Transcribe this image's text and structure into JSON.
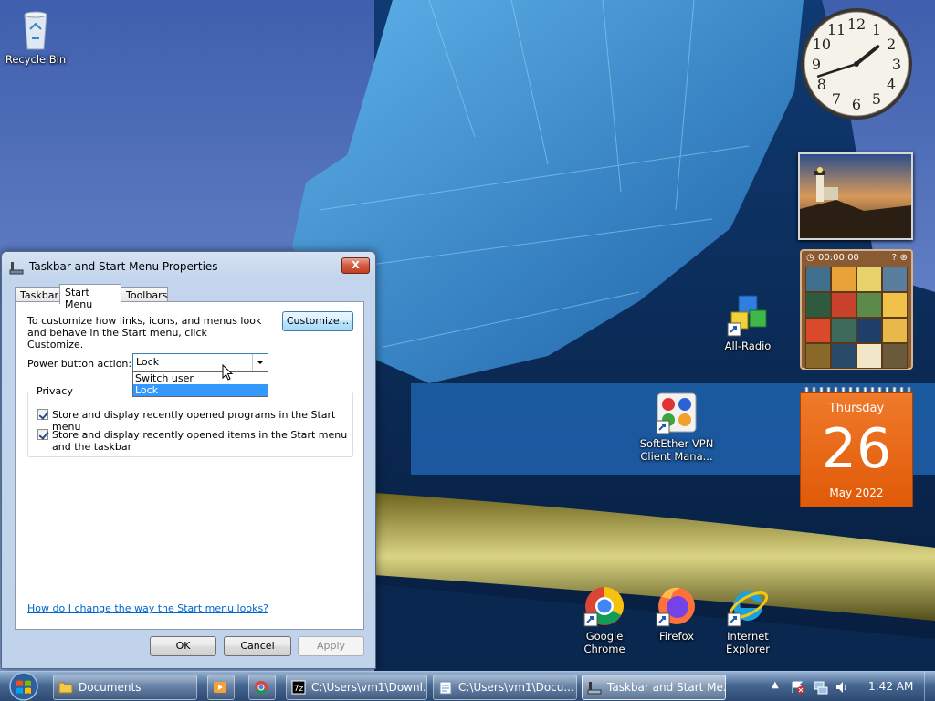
{
  "desktop": {
    "icons": [
      {
        "label": "Recycle Bin",
        "icon": "recycle-bin-icon"
      },
      {
        "label": "All-Radio",
        "icon": "all-radio-icon"
      },
      {
        "label": "SoftEther VPN Client Mana...",
        "icon": "softether-vpn-icon"
      },
      {
        "label": "Google Chrome",
        "icon": "chrome-icon"
      },
      {
        "label": "Firefox",
        "icon": "firefox-icon"
      },
      {
        "label": "Internet Explorer",
        "icon": "internet-explorer-icon"
      }
    ]
  },
  "gadgets": {
    "clock": {
      "numbers": [
        "12",
        "1",
        "2",
        "3",
        "4",
        "5",
        "6",
        "7",
        "8",
        "9",
        "10",
        "11"
      ],
      "time": "1:42"
    },
    "puzzle": {
      "timer": "00:00:00"
    },
    "calendar": {
      "weekday": "Thursday",
      "day": "26",
      "month_year": "May 2022"
    }
  },
  "dialog": {
    "title": "Taskbar and Start Menu Properties",
    "close_label": "X",
    "tabs": [
      "Taskbar",
      "Start Menu",
      "Toolbars"
    ],
    "active_tab": "Start Menu",
    "intro_text": "To customize how links, icons, and menus look and behave in the Start menu, click Customize.",
    "customize_label": "Customize...",
    "power_button_label": "Power button action:",
    "power_button_value": "Lock",
    "power_button_options": [
      "Switch user",
      "Lock"
    ],
    "highlighted_option": "Lock",
    "privacy_legend": "Privacy",
    "checkboxes": [
      {
        "label": "Store and display recently opened programs in the Start menu",
        "checked": true
      },
      {
        "label": "Store and display recently opened items in the Start menu and the taskbar",
        "checked": true
      }
    ],
    "help_link": "How do I change the way the Start menu looks?",
    "ok_label": "OK",
    "cancel_label": "Cancel",
    "apply_label": "Apply"
  },
  "taskbar": {
    "items": [
      {
        "label": "Documents",
        "icon": "folder-icon"
      },
      {
        "label": "",
        "icon": "media-player-icon"
      },
      {
        "label": "",
        "icon": "chrome-icon"
      },
      {
        "label": "C:\\Users\\vm1\\Downl...",
        "icon": "7zip-icon"
      },
      {
        "label": "C:\\Users\\vm1\\Docu...",
        "icon": "notepad-icon"
      },
      {
        "label": "Taskbar and Start Me...",
        "icon": "taskbar-properties-icon"
      }
    ],
    "clock": "1:42 AM"
  },
  "colors": {
    "calendar_orange": "#e8620f",
    "selection_blue": "#3399ff",
    "link_blue": "#0066cc"
  }
}
